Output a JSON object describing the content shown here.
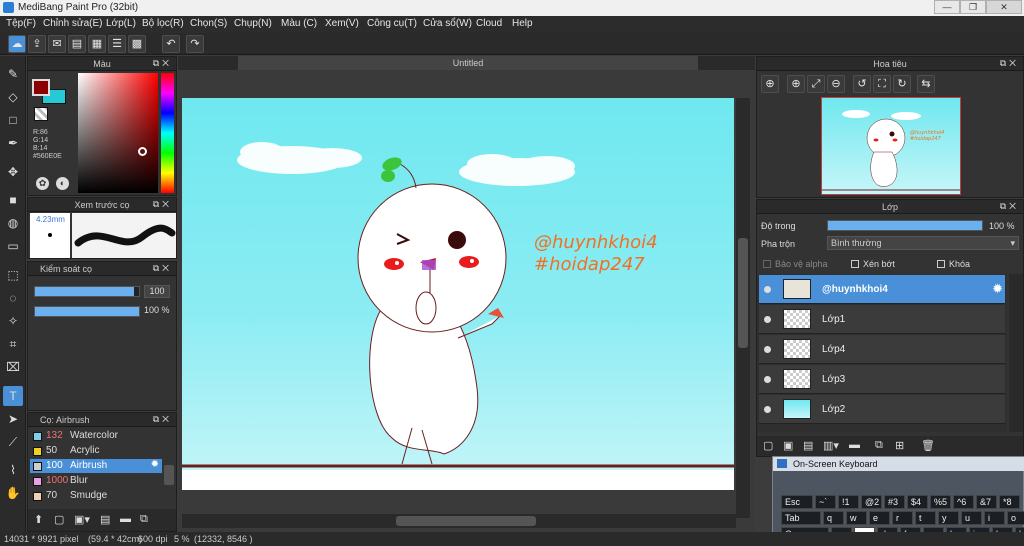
{
  "window": {
    "title": "MediBang Paint Pro (32bit)",
    "minimize": "—",
    "maximize": "❐",
    "close": "✕"
  },
  "menu": [
    "Tệp(F)",
    "Chỉnh sửa(E)",
    "Lớp(L)",
    "Bộ lọc(R)",
    "Chọn(S)",
    "Chụp(N)",
    "Màu (C)",
    "Xem(V)",
    "Công cụ(T)",
    "Cửa sổ(W)",
    "Cloud",
    "Help"
  ],
  "color_panel": {
    "title": "Màu",
    "r": "R:86",
    "g": "G:14",
    "b": "B:14",
    "hex": "#560E0E",
    "primary_color": "#8b0000",
    "secondary_color": "#27c9d6"
  },
  "brush_preview": {
    "title": "Xem trước cọ",
    "size": "4.23mm"
  },
  "brush_control": {
    "title": "Kiểm soát cọ",
    "size_value": "100",
    "opacity_value": "100 %",
    "size_fraction": 0.95,
    "opacity_fraction": 1.0
  },
  "brush_list": {
    "title": "Cọ: Airbrush",
    "items": [
      {
        "size": "132",
        "name": "Watercolor",
        "color": "#7fd0ef"
      },
      {
        "size": "50",
        "name": "Acrylic",
        "color": "#f0d020"
      },
      {
        "size": "100",
        "name": "Airbrush",
        "color": "#cfcfcf"
      },
      {
        "size": "1000",
        "name": "Blur",
        "color": "#e8a0e8"
      },
      {
        "size": "70",
        "name": "Smudge",
        "color": "#f5d0b0"
      }
    ]
  },
  "canvas": {
    "tab": "Untitled",
    "watermark_line1": "@huynhkhoi4",
    "watermark_line2": "#hoidap247"
  },
  "navigator": {
    "title": "Hoa tiêu",
    "thumb_line1": "@huynhkhoi4",
    "thumb_line2": "#hoidap247"
  },
  "layer_panel": {
    "title": "Lớp",
    "opacity_label": "Độ trong",
    "opacity_value": "100 %",
    "opacity_fraction": 1.0,
    "blend_label": "Pha trộn",
    "blend_value": "Bình thường",
    "protect_alpha": "Bảo vệ alpha",
    "clipping": "Xén bớt",
    "lock": "Khóa",
    "layers": [
      {
        "name": "@huynhkhoi4"
      },
      {
        "name": "Lớp1"
      },
      {
        "name": "Lớp4"
      },
      {
        "name": "Lớp3"
      },
      {
        "name": "Lớp2"
      }
    ]
  },
  "keyboard": {
    "title": "On-Screen Keyboard",
    "row1": [
      "Esc",
      "~`",
      "!1",
      "@2",
      "#3",
      "$4",
      "%5",
      "^6",
      "&7",
      "*8"
    ],
    "row2": [
      "Tab",
      "q",
      "w",
      "e",
      "r",
      "t",
      "y",
      "u",
      "i",
      "o"
    ],
    "row3": [
      "Caps",
      "a",
      "s",
      "d",
      "f",
      "g",
      "h",
      "j",
      "k",
      "l"
    ]
  },
  "status": {
    "size": "14031 * 9921 pixel",
    "cm": "(59.4 * 42cm)",
    "dpi": "600 dpi",
    "zoom": "5 %",
    "coords": "(12332, 8546 )"
  }
}
